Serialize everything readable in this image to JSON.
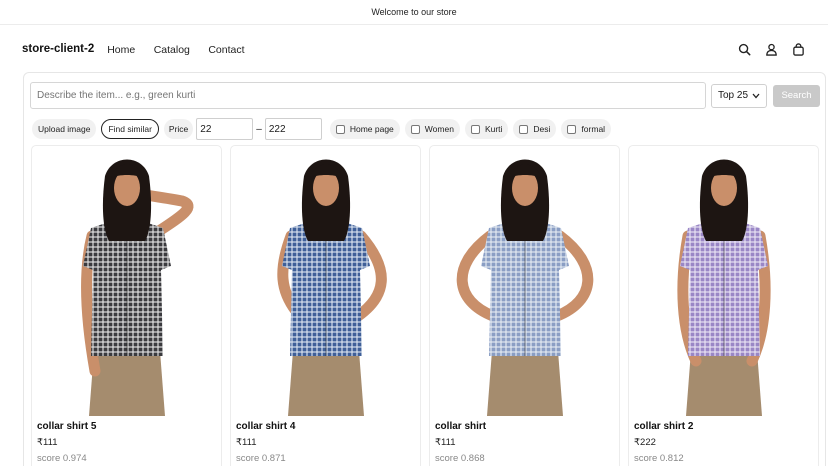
{
  "announcement": "Welcome to our store",
  "header": {
    "brand": "store-client-2",
    "nav": [
      "Home",
      "Catalog",
      "Contact"
    ]
  },
  "search": {
    "placeholder": "Describe the item... e.g., green kurti",
    "top_select": "Top 25",
    "button": "Search"
  },
  "filters": {
    "upload": "Upload image",
    "find_similar": "Find similar",
    "price_label": "Price",
    "price_min": "22",
    "price_max": "222",
    "dash": "–",
    "tags": [
      "Home page",
      "Women",
      "Kurti",
      "Desi",
      "formal"
    ]
  },
  "products": [
    {
      "name": "collar shirt 5",
      "price": "₹111",
      "score": "score 0.974",
      "shirt_color": "#3a3a3e",
      "check_color": "#e8e8e8",
      "pose": "hand-head"
    },
    {
      "name": "collar shirt 4",
      "price": "₹111",
      "score": "score 0.871",
      "shirt_color": "#3f5f98",
      "check_color": "#dfe6f2",
      "pose": "hand-hip"
    },
    {
      "name": "collar shirt",
      "price": "₹111",
      "score": "score 0.868",
      "shirt_color": "#8a9ec4",
      "check_color": "#e7ecf4",
      "pose": "hands-hips"
    },
    {
      "name": "collar shirt 2",
      "price": "₹222",
      "score": "score 0.812",
      "shirt_color": "#9a87c6",
      "check_color": "#ece6f6",
      "pose": "hands-pockets"
    }
  ]
}
